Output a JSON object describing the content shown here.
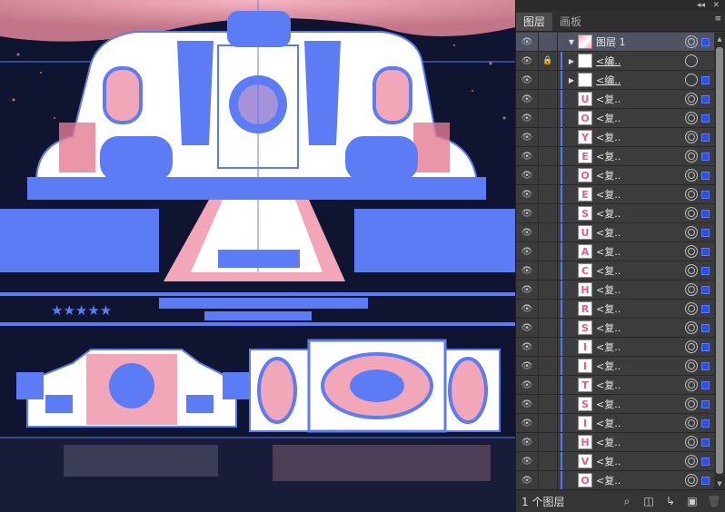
{
  "panel": {
    "tabs": [
      {
        "label": "图层"
      },
      {
        "label": "画板"
      }
    ],
    "top_controls": {
      "collapse": "◂◂",
      "close": "✕"
    },
    "menu_icon": "≡",
    "layer_count_label": "1 个图层",
    "layers": [
      {
        "name": "图层 1",
        "thumb": "",
        "parent": true,
        "expanded": true
      },
      {
        "name": "<编..",
        "thumb": "",
        "locked": true,
        "collapsed": true
      },
      {
        "name": "<编..",
        "thumb": "",
        "collapsed": true
      },
      {
        "name": "<复..",
        "thumb": "U"
      },
      {
        "name": "<复..",
        "thumb": "O"
      },
      {
        "name": "<复..",
        "thumb": "Y"
      },
      {
        "name": "<复..",
        "thumb": "E"
      },
      {
        "name": "<复..",
        "thumb": "O"
      },
      {
        "name": "<复..",
        "thumb": "E"
      },
      {
        "name": "<复..",
        "thumb": "S"
      },
      {
        "name": "<复..",
        "thumb": "U"
      },
      {
        "name": "<复..",
        "thumb": "A"
      },
      {
        "name": "<复..",
        "thumb": "C"
      },
      {
        "name": "<复..",
        "thumb": "H"
      },
      {
        "name": "<复..",
        "thumb": "R"
      },
      {
        "name": "<复..",
        "thumb": "S"
      },
      {
        "name": "<复..",
        "thumb": "I"
      },
      {
        "name": "<复..",
        "thumb": "I"
      },
      {
        "name": "<复..",
        "thumb": "T"
      },
      {
        "name": "<复..",
        "thumb": "S"
      },
      {
        "name": "<复..",
        "thumb": "I"
      },
      {
        "name": "<复..",
        "thumb": "H"
      },
      {
        "name": "<复..",
        "thumb": "V"
      },
      {
        "name": "<复..",
        "thumb": "O"
      }
    ],
    "bottom_icons": [
      "search-icon",
      "make-clipping-mask-icon",
      "new-sublayer-icon",
      "new-layer-icon",
      "delete-icon"
    ]
  },
  "canvas": {
    "stars": "★★★★★",
    "colors": {
      "selection": "#5b7cf5",
      "pink": "#f2a7b8",
      "white": "#ffffff",
      "bg": "#0f1530"
    }
  }
}
